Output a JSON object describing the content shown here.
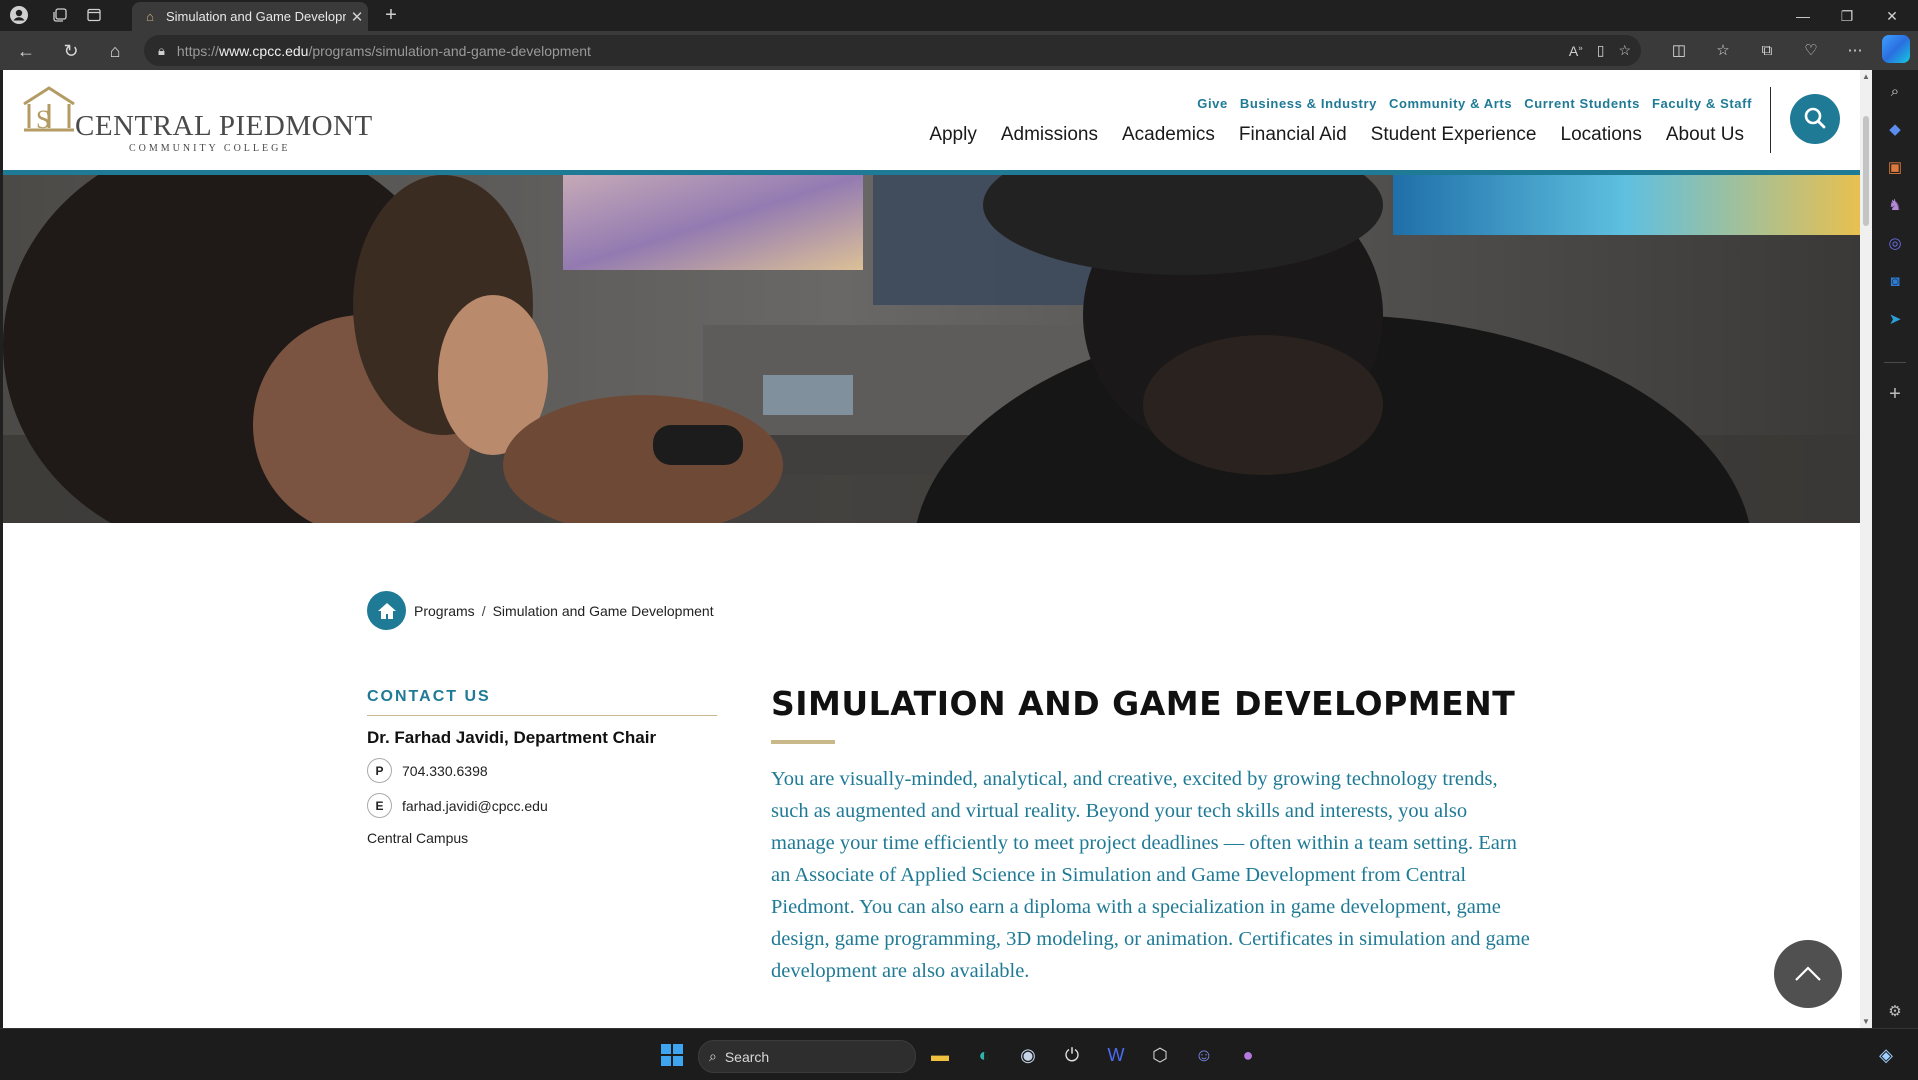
{
  "browser": {
    "tab_title": "Simulation and Game Developm",
    "url_prefix": "https://",
    "url_domain": "www.cpcc.edu",
    "url_path": "/programs/simulation-and-game-development"
  },
  "site": {
    "logo_name": "CENTRAL PIEDMONT",
    "logo_sub": "COMMUNITY COLLEGE",
    "utility_links": [
      "Give",
      "Business & Industry",
      "Community & Arts",
      "Current Students",
      "Faculty & Staff"
    ],
    "main_nav": [
      "Apply",
      "Admissions",
      "Academics",
      "Financial Aid",
      "Student Experience",
      "Locations",
      "About Us"
    ],
    "accent_color": "#1f7a96",
    "gold_color": "#c9b98a"
  },
  "breadcrumb": {
    "items": [
      "Programs",
      "Simulation and Game Development"
    ],
    "separator": "/"
  },
  "contact": {
    "heading": "CONTACT US",
    "name": "Dr. Farhad Javidi, Department Chair",
    "phone_badge": "P",
    "phone": "704.330.6398",
    "email_badge": "E",
    "email": "farhad.javidi@cpcc.edu",
    "campus": "Central Campus"
  },
  "page": {
    "title": "SIMULATION AND GAME DEVELOPMENT",
    "intro": "You are visually-minded, analytical, and creative, excited by growing technology trends, such as augmented and virtual reality. Beyond your tech skills and interests, you also manage your time efficiently to meet project deadlines — often within a team setting. Earn an Associate of Applied Science in Simulation and Game Development from Central Piedmont. You can also earn a diploma with a specialization in game development, game design, game programming, 3D modeling, or animation. Certificates in simulation and game development are also available."
  },
  "taskbar": {
    "search_label": "Search"
  }
}
